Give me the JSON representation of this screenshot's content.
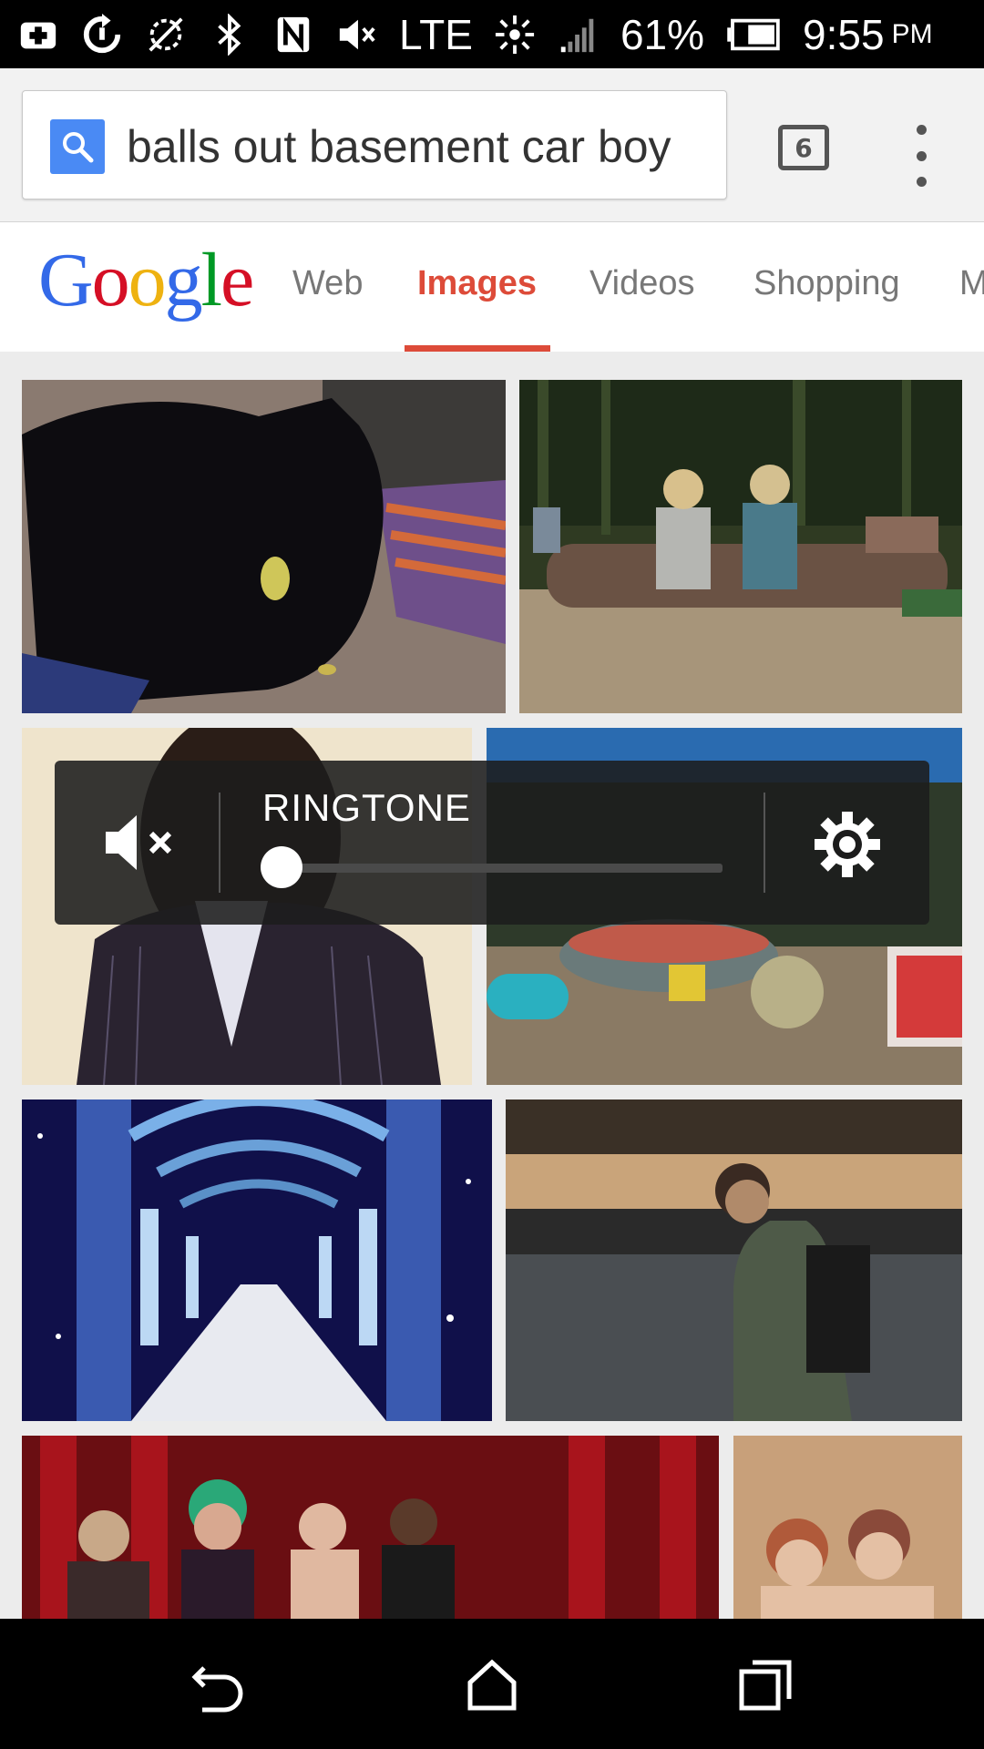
{
  "status_bar": {
    "icons": [
      "medical-plus-icon",
      "sync-icon",
      "no-signal-icon",
      "bluetooth-icon",
      "nfc-icon",
      "mute-icon"
    ],
    "network": "LTE",
    "battery": "61%",
    "time": "9:55",
    "ampm": "PM"
  },
  "omnibox": {
    "query": "balls out basement car boy",
    "tab_count": "6"
  },
  "google_nav": {
    "logo_letters": [
      "G",
      "o",
      "o",
      "g",
      "l",
      "e"
    ],
    "logo_colors": [
      "#3369e8",
      "#d50f25",
      "#eeb211",
      "#3369e8",
      "#009925",
      "#d50f25"
    ],
    "tabs": [
      "Web",
      "Images",
      "Videos",
      "Shopping",
      "M"
    ],
    "active_tab": "Images",
    "active_color": "#dd4b39"
  },
  "volume_panel": {
    "label": "RINGTONE",
    "level": 0
  }
}
